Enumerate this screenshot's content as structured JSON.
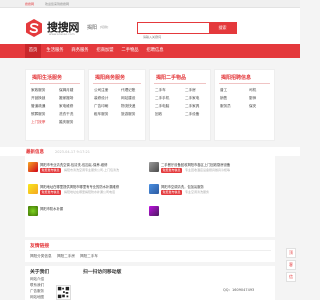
{
  "topbar": {
    "left": "搜搜网",
    "welcome": "欢迎您来到搜搜网"
  },
  "header": {
    "brand": "搜搜网",
    "domain": "www.sososo.com",
    "city": "揭阳",
    "city_switch": "[切换]",
    "search_placeholder": "请输入关键词",
    "search_button": "搜索"
  },
  "nav": {
    "items": [
      "首页",
      "生活服务",
      "商务服务",
      "招商加盟",
      "二手物品",
      "招聘信息"
    ]
  },
  "categories": [
    {
      "title": "揭阳生活服务",
      "links": [
        "家政服务",
        "保姆月嫂",
        "开锁换锁",
        "搬家搬场",
        "管道疏通",
        "家电维修",
        "殡葬服务",
        "洗衣干洗",
        "上门按摩",
        "婚庆服务",
        "宠物服务",
        "清洗保洁"
      ]
    },
    {
      "title": "揭阳商务服务",
      "links": [
        "公司注册",
        "代理记账",
        "装修设计",
        "网站建设",
        "广告印刷",
        "物流快递",
        "租车服务",
        "旅游服务",
        "律师服务",
        "翻译服务",
        "展会服务",
        "投资担保"
      ]
    },
    {
      "title": "揭阳二手物品",
      "links": [
        "二手车",
        "二手房",
        "二手手机",
        "二手家电",
        "二手电脑",
        "二手家具",
        "二手设备",
        "回收"
      ]
    },
    {
      "title": "揭阳招聘信息",
      "links": [
        "普工",
        "司机",
        "销售",
        "厨师",
        "服务员",
        "保安"
      ]
    }
  ],
  "latest": {
    "title": "最新信息",
    "date": "2023-04-17 9:17:21"
  },
  "posts": [
    {
      "text": "揭阳市专业清洗空调-包清洗-包加氟-保养-维修",
      "tag": "免费发布信息",
      "snippet": "揭阳市清洗空调专业服务公司,上门包清洗"
    },
    {
      "text": "二手餐厅设备回收揭阳市各区上门回收厨房设备",
      "tag": "免费发布信息",
      "snippet": "专业回收酒店设备厨具餐具冷柜等"
    },
    {
      "text": "揭阳地址在哪里提供揭阳市哪里有专业的防水补漏维修",
      "tag": "免费发布信息",
      "snippet": "揭阳地址在哪里揭阳防水补漏公司电话"
    },
    {
      "text": "揭阳市空调清洗，包加氟服务",
      "tag": "免费发布信息",
      "snippet": "专业空调清洗服务"
    },
    {
      "text": "揭阳市防水补漏",
      "tag": "",
      "snippet": ""
    }
  ],
  "friend_links": {
    "title": "友情链接",
    "links": [
      "揭阳分类信息",
      "揭阳二手房",
      "揭阳二手车"
    ]
  },
  "contact": {
    "about_title": "关于我们",
    "lines": [
      "网站介绍",
      "联系我们",
      "广告服务",
      "网站地图"
    ],
    "qr_title": "扫一扫访问移动版",
    "qq": "QQ：1609047493"
  },
  "side": [
    "顶",
    "客",
    "信"
  ]
}
